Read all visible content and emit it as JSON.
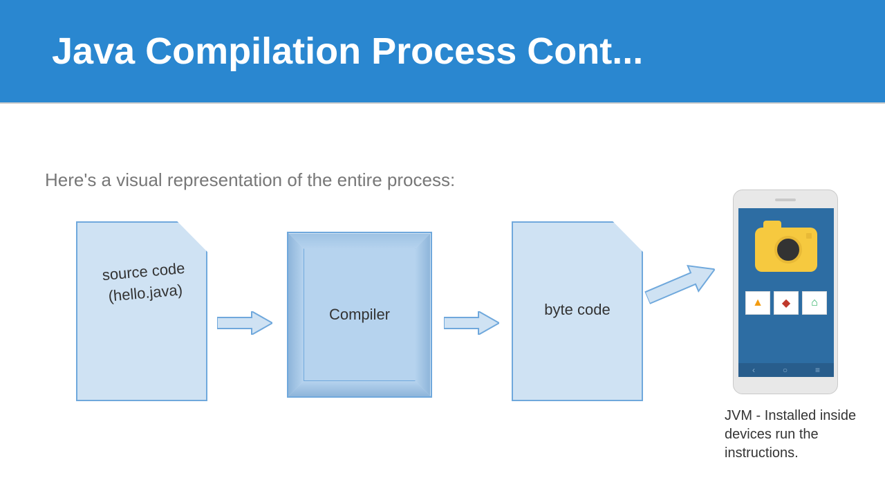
{
  "header": {
    "title": "Java Compilation Process Cont..."
  },
  "intro_text": "Here's a visual representation of the entire process:",
  "nodes": {
    "source": {
      "label_line1": "source code",
      "label_line2": "(hello.java)"
    },
    "compiler": {
      "label": "Compiler"
    },
    "bytecode": {
      "label": "byte code"
    }
  },
  "jvm_caption": "JVM - Installed inside devices run the instructions.",
  "colors": {
    "header_bg": "#2a87d0",
    "box_fill": "#cfe2f3",
    "box_stroke": "#6fa8dc"
  },
  "chart_data": {
    "type": "diagram",
    "title": "Java Compilation Process",
    "flow": [
      {
        "id": "source",
        "label": "source code (hello.java)",
        "shape": "file"
      },
      {
        "id": "compiler",
        "label": "Compiler",
        "shape": "process-3d"
      },
      {
        "id": "bytecode",
        "label": "byte code",
        "shape": "file"
      },
      {
        "id": "device",
        "label": "JVM - Installed inside devices run the instructions.",
        "shape": "device"
      }
    ],
    "edges": [
      {
        "from": "source",
        "to": "compiler"
      },
      {
        "from": "compiler",
        "to": "bytecode"
      },
      {
        "from": "bytecode",
        "to": "device"
      }
    ]
  }
}
